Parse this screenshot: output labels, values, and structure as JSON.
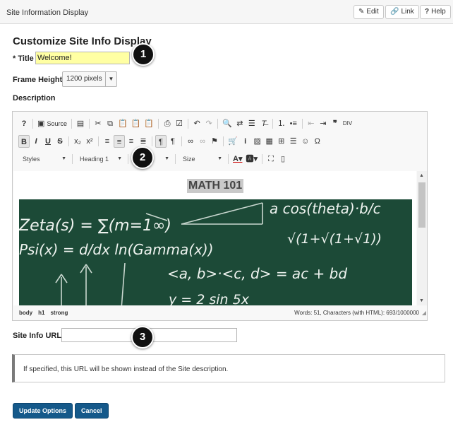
{
  "header": {
    "title": "Site Information Display",
    "edit_label": "Edit",
    "link_label": "Link",
    "help_label": "Help",
    "edit_icon": "✎",
    "link_icon": "🔗",
    "help_icon": "?"
  },
  "form": {
    "heading": "Customize Site Info Display",
    "title_label": "* Title",
    "title_value": "Welcome!",
    "frame_height_label": "Frame Height",
    "frame_height_value": "1200 pixels",
    "description_label": "Description",
    "site_info_url_label": "Site Info URL",
    "site_info_url_value": "",
    "info_text": "If specified, this URL will be shown instead of the Site description."
  },
  "editor": {
    "toolbar_row1": [
      "?",
      "Source"
    ],
    "toolbar_row3": {
      "styles": "Styles",
      "format": "Heading 1",
      "font": "F",
      "size": "Size"
    },
    "content_heading": "MATH 101",
    "element_path": [
      "body",
      "h1",
      "strong"
    ],
    "word_count": "Words: 51, Characters (with HTML): 693/1000000",
    "chalk_lines": [
      "Zeta(s) = ∑(m=1∞)",
      "a  cos(theta)·b/c",
      "Psi(x) = d/dx ln(Gamma(x))",
      "√(1+√(1+√1))",
      "<a, b>·<c, d> = ac + bd",
      "y = 2 sin 5x"
    ],
    "chalkboard_color": "#1c4a37"
  },
  "buttons": {
    "update": "Update Options",
    "cancel": "Cancel"
  },
  "callouts": [
    "1",
    "2",
    "3"
  ],
  "colors": {
    "primary_button": "#15598a",
    "title_highlight": "#ffffa3"
  }
}
